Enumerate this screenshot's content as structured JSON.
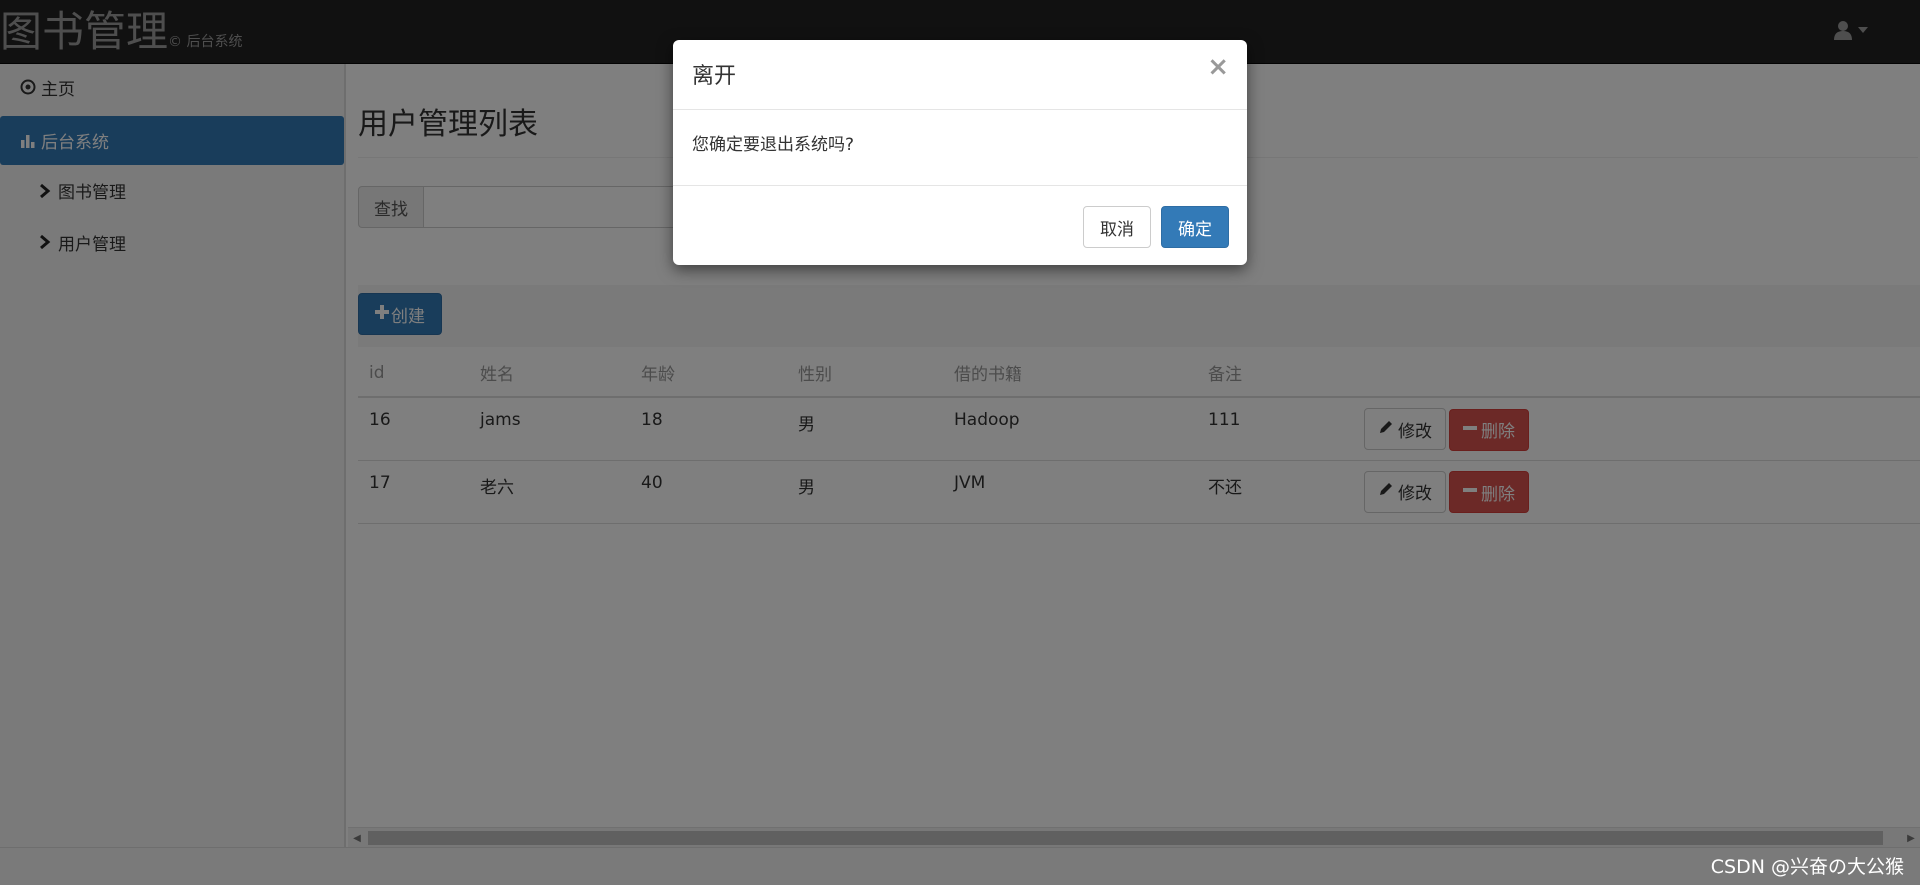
{
  "navbar": {
    "brand": "图书管理",
    "brand_sub": "© 后台系统",
    "user_icon": "user-icon"
  },
  "sidebar": {
    "items": [
      {
        "label": "主页",
        "icon": "circle-play-icon"
      },
      {
        "label": "后台系统",
        "icon": "bar-chart-icon",
        "active": true
      },
      {
        "label": "图书管理",
        "icon": "chevron-right-icon"
      },
      {
        "label": "用户管理",
        "icon": "chevron-right-icon"
      }
    ]
  },
  "main": {
    "title": "用户管理列表",
    "search": {
      "addon": "查找",
      "value": "",
      "placeholder": ""
    },
    "create_label": "创建",
    "table": {
      "headers": [
        "id",
        "姓名",
        "年龄",
        "性别",
        "借的书籍",
        "备注"
      ],
      "rows": [
        {
          "id": "16",
          "name": "jams",
          "age": "18",
          "sex": "男",
          "book": "Hadoop",
          "note": "111"
        },
        {
          "id": "17",
          "name": "老六",
          "age": "40",
          "sex": "男",
          "book": "JVM",
          "note": "不还"
        }
      ],
      "edit_label": "修改",
      "delete_label": "删除"
    }
  },
  "modal": {
    "title": "离开",
    "close": "×",
    "message": "您确定要退出系统吗?",
    "cancel_label": "取消",
    "ok_label": "确定"
  },
  "watermark": "CSDN @兴奋の大公猴",
  "colors": {
    "primary": "#337ab7",
    "danger": "#d9534f",
    "navbar": "#222222"
  }
}
